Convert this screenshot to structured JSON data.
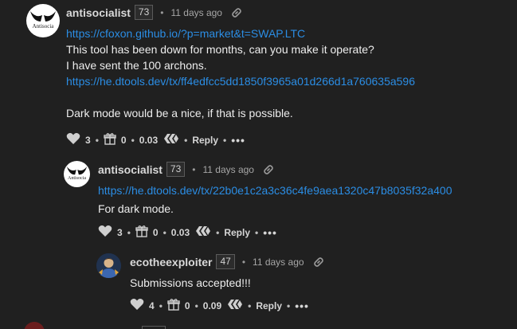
{
  "comments": [
    {
      "author": "antisocialist",
      "reputation": "73",
      "time": "11 days ago",
      "lines": [
        {
          "type": "link",
          "text": "https://cfoxon.github.io/?p=market&t=SWAP.LTC"
        },
        {
          "type": "text",
          "text": "This tool has been down for months, can you make it operate?"
        },
        {
          "type": "text",
          "text": "I have sent the 100 archons."
        },
        {
          "type": "link",
          "text": "https://he.dtools.dev/tx/ff4edfcc5dd1850f3965a01d266d1a760635a596"
        },
        {
          "type": "gap",
          "text": ""
        },
        {
          "type": "text",
          "text": "Dark mode would be a nice, if that is possible."
        }
      ],
      "votes": "3",
      "gifts": "0",
      "payout": "0.03",
      "reply_label": "Reply",
      "more_label": "•••"
    },
    {
      "author": "antisocialist",
      "reputation": "73",
      "time": "11 days ago",
      "lines": [
        {
          "type": "link",
          "text": "https://he.dtools.dev/tx/22b0e1c2a3c36c4fe9aea1320c47b8035f32a400"
        },
        {
          "type": "text",
          "text": "For dark mode."
        }
      ],
      "votes": "3",
      "gifts": "0",
      "payout": "0.03",
      "reply_label": "Reply",
      "more_label": "•••"
    },
    {
      "author": "ecotheexploiter",
      "reputation": "47",
      "time": "11 days ago",
      "lines": [
        {
          "type": "text",
          "text": "Submissions accepted!!!"
        }
      ],
      "votes": "4",
      "gifts": "0",
      "payout": "0.09",
      "reply_label": "Reply",
      "more_label": "•••"
    }
  ],
  "icons": {
    "heart": "heart-icon",
    "gift": "gift-icon",
    "hive": "hive-icon",
    "link": "link-icon"
  },
  "colors": {
    "background": "#202020",
    "link": "#2b8de4",
    "text": "#ededed"
  },
  "avatar_text": "Antisocia"
}
